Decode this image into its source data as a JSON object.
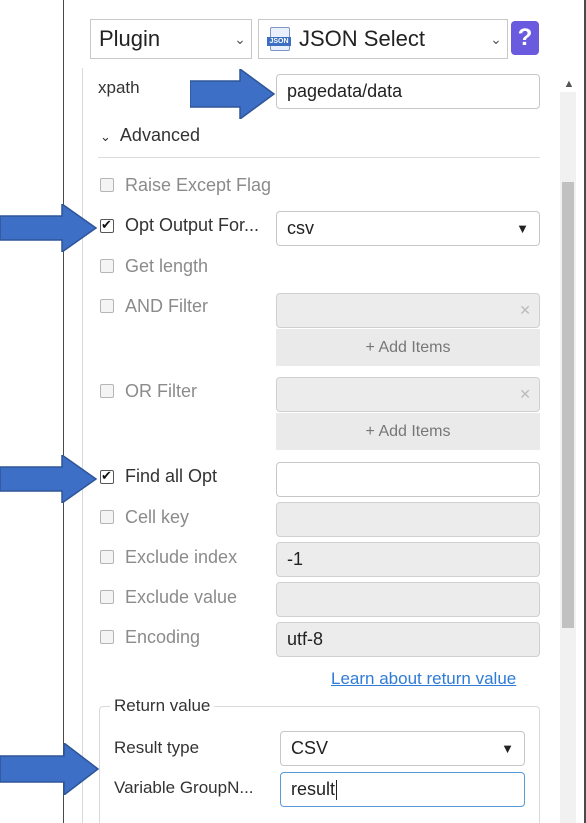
{
  "toolbar": {
    "plugin_select": "Plugin",
    "module_select": "JSON Select",
    "json_icon_text": "JSON",
    "help_label": "?"
  },
  "xpath": {
    "label": "xpath",
    "value": "pagedata/data"
  },
  "advanced": {
    "label": "Advanced"
  },
  "options": {
    "raise_except_flag": {
      "label": "Raise Except Flag",
      "checked": false
    },
    "opt_output_format": {
      "label": "Opt Output For...",
      "checked": true,
      "value": "csv"
    },
    "get_length": {
      "label": "Get length",
      "checked": false
    },
    "and_filter": {
      "label": "AND Filter",
      "checked": false,
      "add_label": "+ Add Items"
    },
    "or_filter": {
      "label": "OR Filter",
      "checked": false,
      "add_label": "+ Add Items"
    },
    "find_all_opt": {
      "label": "Find all Opt",
      "checked": true,
      "value": ""
    },
    "cell_key": {
      "label": "Cell key",
      "checked": false,
      "value": ""
    },
    "exclude_index": {
      "label": "Exclude index",
      "checked": false,
      "value": "-1"
    },
    "exclude_value": {
      "label": "Exclude value",
      "checked": false,
      "value": ""
    },
    "encoding": {
      "label": "Encoding",
      "checked": false,
      "value": "utf-8"
    }
  },
  "learn_link": "Learn about return value",
  "return_value": {
    "legend": "Return value",
    "result_type_label": "Result type",
    "result_type_value": "CSV",
    "variable_label": "Variable GroupN...",
    "variable_value": "result"
  },
  "colors": {
    "arrow": "#3d6fc6",
    "help": "#6a5bde",
    "link": "#2f7bd8"
  }
}
